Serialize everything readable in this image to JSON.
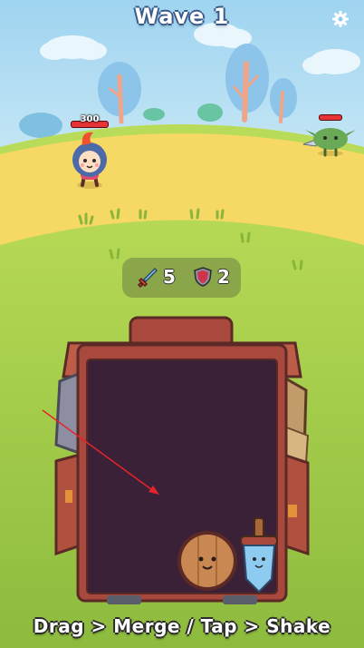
{
  "header": {
    "title": "Wave 1",
    "settings_icon": "gear-icon"
  },
  "battle": {
    "player": {
      "hp": "300",
      "hp_fill": 1.0
    },
    "enemy": {
      "type": "goblin",
      "hp_fill": 1.0
    }
  },
  "stats": {
    "attack": "5",
    "defense": "2",
    "attack_icon": "sword-icon",
    "defense_icon": "shield-icon"
  },
  "backpack": {
    "items": [
      "round-shield",
      "sword"
    ]
  },
  "footer": {
    "hint": "Drag > Merge / Tap > Shake"
  },
  "colors": {
    "sky": "#9fd4f0",
    "sand": "#f6d865",
    "grass": "#a6cd4f",
    "backpack": "#a9483d",
    "interior": "#3b2137"
  }
}
